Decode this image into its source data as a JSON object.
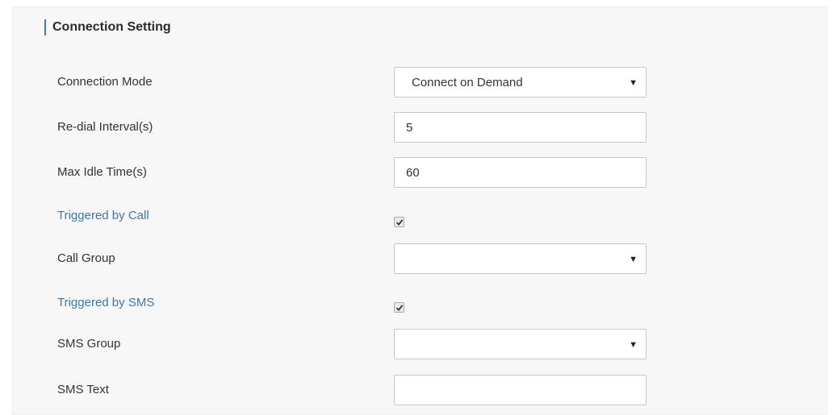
{
  "section": {
    "title": "Connection Setting"
  },
  "fields": {
    "connection_mode": {
      "label": "Connection Mode",
      "value": "Connect on Demand"
    },
    "redial_interval": {
      "label": "Re-dial Interval(s)",
      "value": "5"
    },
    "max_idle_time": {
      "label": "Max Idle Time(s)",
      "value": "60"
    },
    "triggered_by_call": {
      "label": "Triggered by Call",
      "checked": true
    },
    "call_group": {
      "label": "Call Group",
      "value": ""
    },
    "triggered_by_sms": {
      "label": "Triggered by SMS",
      "checked": true
    },
    "sms_group": {
      "label": "SMS Group",
      "value": ""
    },
    "sms_text": {
      "label": "SMS Text",
      "value": ""
    }
  },
  "icons": {
    "dropdown": "caret-down-icon",
    "check": "checkmark-icon"
  },
  "colors": {
    "accent": "#3a7bbf",
    "link_label": "#3a78b5",
    "panel_bg": "#f7f7f7"
  }
}
